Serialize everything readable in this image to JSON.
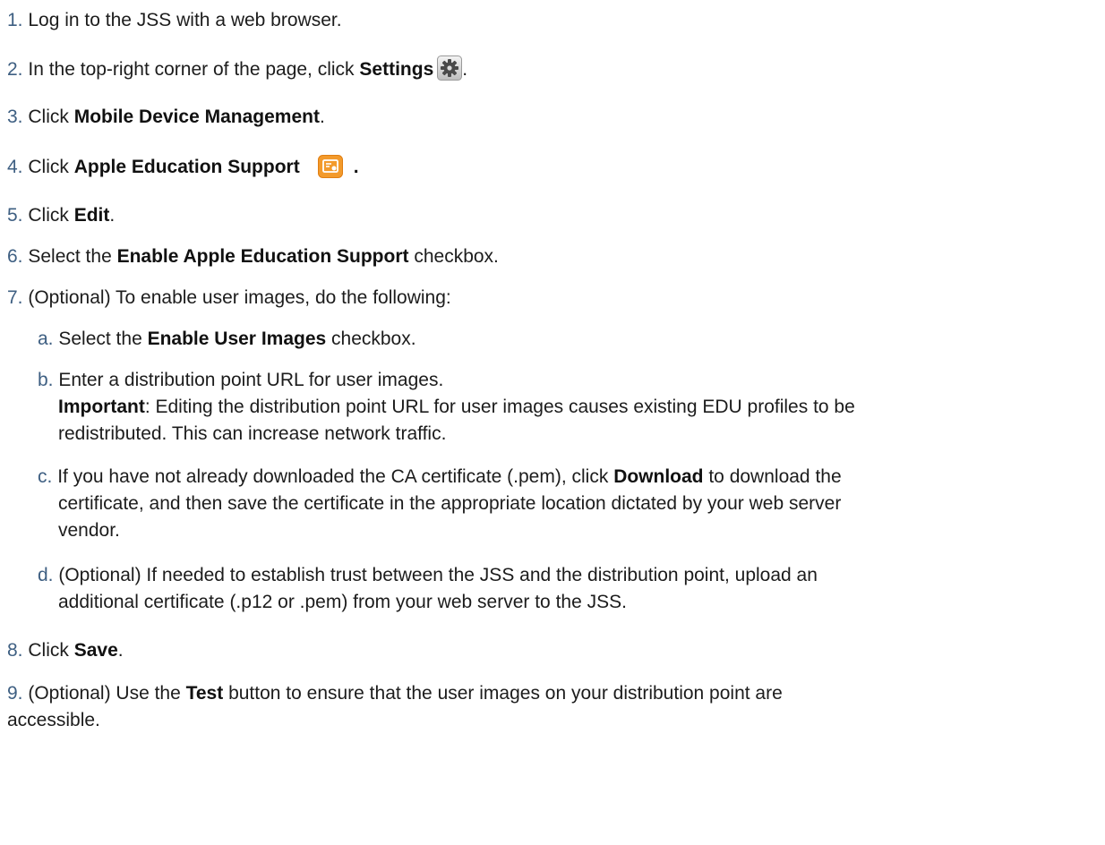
{
  "steps": [
    {
      "num": "1.",
      "text": "Log in to the JSS with a web browser."
    },
    {
      "num": "2.",
      "pre": "In the top-right corner of the page, click ",
      "bold": "Settings",
      "post": "."
    },
    {
      "num": "3.",
      "pre": "Click ",
      "bold": "Mobile Device Management",
      "post": "."
    },
    {
      "num": "4.",
      "pre": "Click ",
      "bold": "Apple Education Support",
      "post": "."
    },
    {
      "num": "5.",
      "pre": "Click ",
      "bold": "Edit",
      "post": "."
    },
    {
      "num": "6.",
      "pre": "Select the ",
      "bold": "Enable Apple Education Support",
      "post": " checkbox."
    },
    {
      "num": "7.",
      "text": "(Optional) To enable user images, do the following:"
    },
    {
      "num": "8.",
      "pre": "Click ",
      "bold": "Save",
      "post": "."
    },
    {
      "num": "9.",
      "pre": "(Optional) Use the ",
      "bold": "Test",
      "post": " button to ensure that the user images on your distribution point are",
      "cont": "accessible."
    }
  ],
  "substeps": [
    {
      "letter": "a.",
      "pre": "Select the ",
      "bold": "Enable User Images",
      "post": " checkbox."
    },
    {
      "letter": "b.",
      "text": "Enter a distribution point URL for user images.",
      "important_label": "Important",
      "important_text": ": Editing the distribution point URL for user images causes existing EDU profiles to be",
      "important_cont": "redistributed. This can increase network traffic."
    },
    {
      "letter": "c.",
      "pre": "If you have not already downloaded the CA certificate (.pem), click ",
      "bold": "Download",
      "post": " to download the",
      "cont1": "certificate, and then save the certificate in the appropriate location dictated by your web server",
      "cont2": "vendor."
    },
    {
      "letter": "d.",
      "text": "(Optional) If needed to establish trust between the JSS and the distribution point, upload an",
      "cont": "additional certificate (.p12 or .pem) from your web server to the JSS."
    }
  ],
  "icons": {
    "settings": "gear-icon",
    "apple_education": "apple-education-icon",
    "accent": "#f39a2b",
    "number_color": "#3e5f82"
  }
}
